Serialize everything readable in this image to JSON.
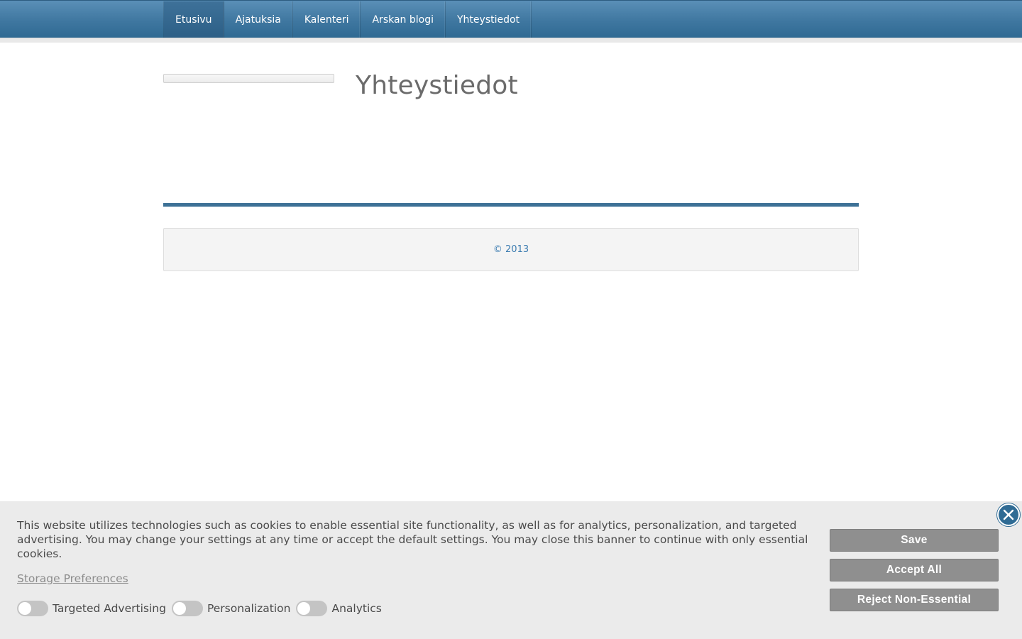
{
  "nav": {
    "items": [
      {
        "label": "Etusivu",
        "active": true
      },
      {
        "label": "Ajatuksia",
        "active": false
      },
      {
        "label": "Kalenteri",
        "active": false
      },
      {
        "label": "Arskan blogi",
        "active": false
      },
      {
        "label": "Yhteystiedot",
        "active": false
      }
    ]
  },
  "main": {
    "title": "Yhteystiedot"
  },
  "footer": {
    "copyright": "© 2013"
  },
  "cookie_banner": {
    "text": "This website utilizes technologies such as cookies to enable essential site functionality, as well as for analytics, personalization, and targeted advertising. You may change your settings at any time or accept the default settings. You may close this banner to continue with only essential cookies.",
    "storage_link": "Storage Preferences",
    "toggles": [
      {
        "label": "Targeted Advertising",
        "on": false
      },
      {
        "label": "Personalization",
        "on": false
      },
      {
        "label": "Analytics",
        "on": false
      }
    ],
    "buttons": {
      "save": "Save",
      "accept_all": "Accept All",
      "reject": "Reject Non-Essential"
    },
    "close_icon": "close-circle-icon"
  },
  "colors": {
    "nav_blue": "#3f77a0",
    "accent": "#3d7196",
    "button_gray": "#8f8f8f"
  }
}
